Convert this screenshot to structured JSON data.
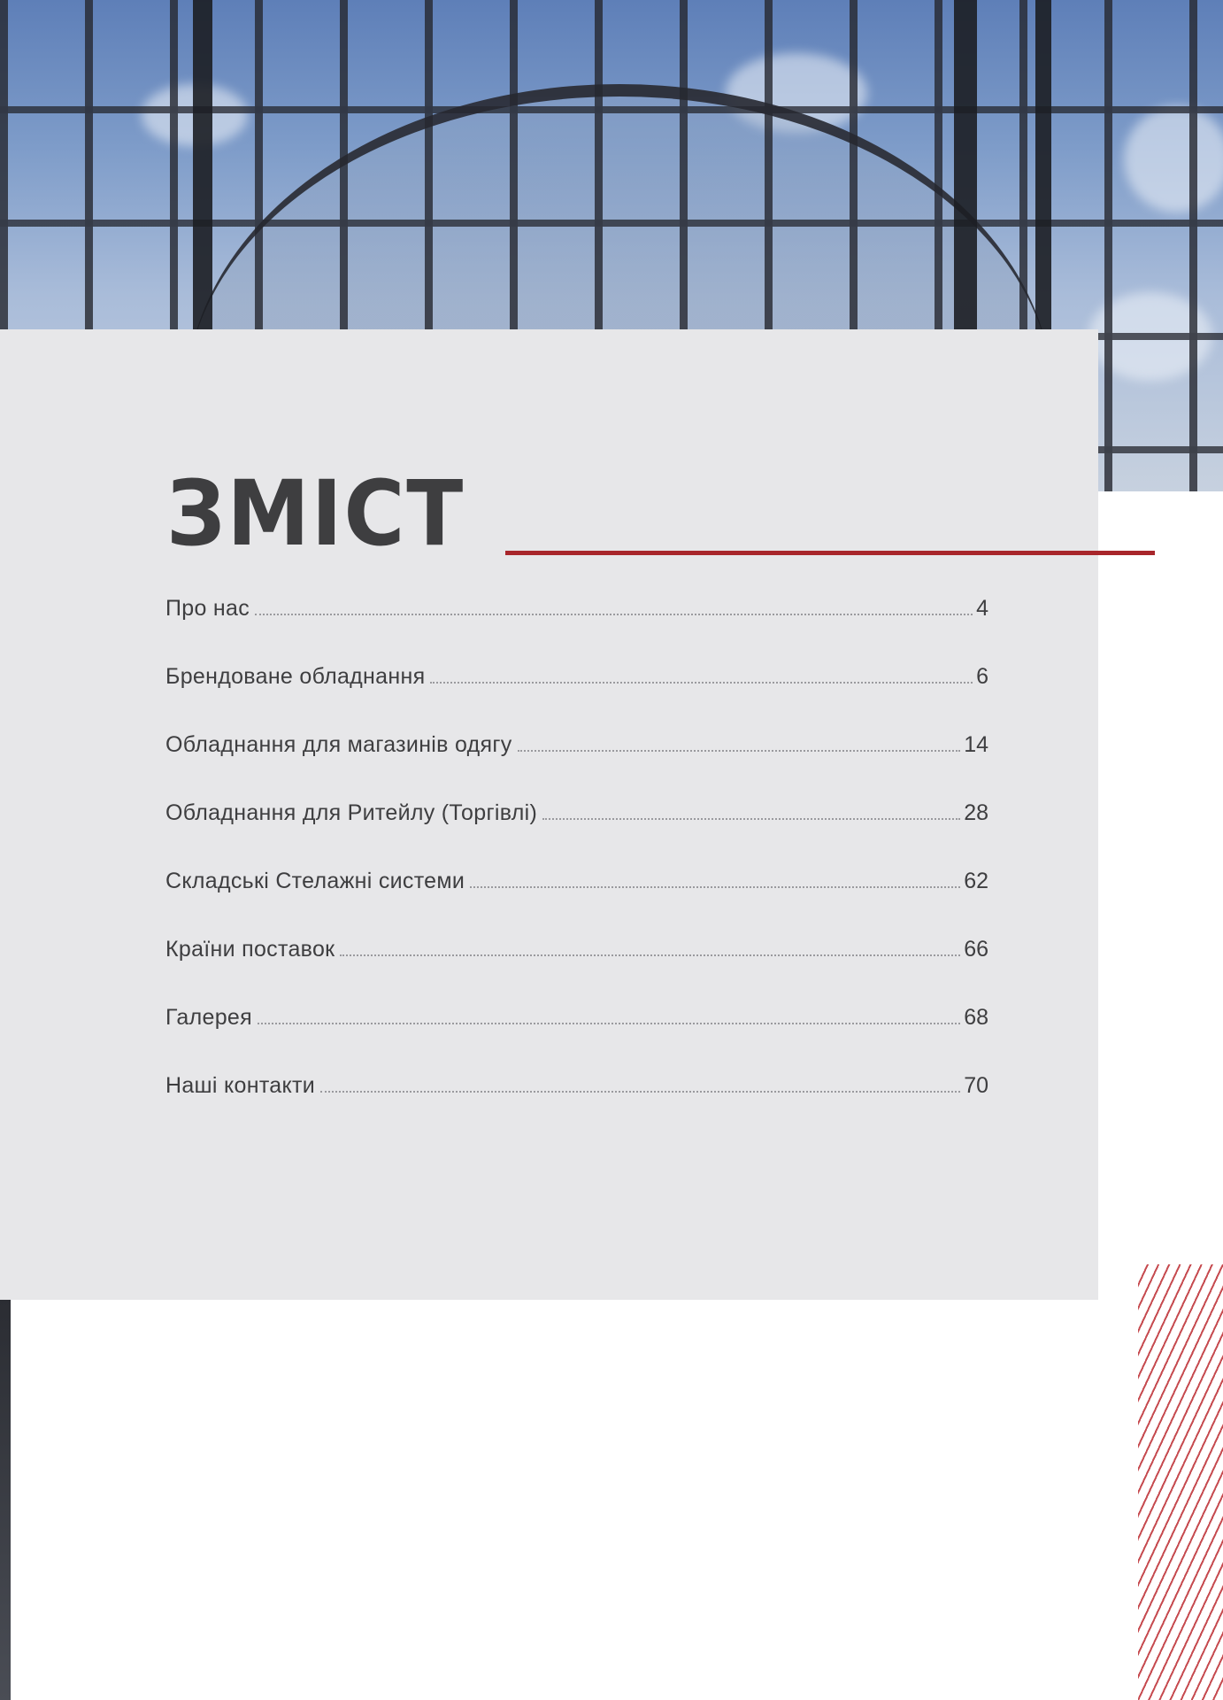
{
  "colors": {
    "panel": "#e7e7e9",
    "title": "#3e3e40",
    "accent": "#a8262b",
    "hatch": "#c0373c"
  },
  "photo": {
    "icon": "building-photo"
  },
  "toc": {
    "title": "ЗМІСТ",
    "entries": [
      {
        "label": "Про нас",
        "page": "4"
      },
      {
        "label": "Брендоване обладнання",
        "page": "6"
      },
      {
        "label": "Обладнання для магазинів одягу",
        "page": "14"
      },
      {
        "label": "Обладнання для Ритейлу (Торгівлі)",
        "page": "28"
      },
      {
        "label": "Складські Стелажні системи",
        "page": "62"
      },
      {
        "label": "Країни поставок",
        "page": "66"
      },
      {
        "label": "Галерея",
        "page": "68"
      },
      {
        "label": "Наші контакти",
        "page": "70"
      }
    ]
  }
}
